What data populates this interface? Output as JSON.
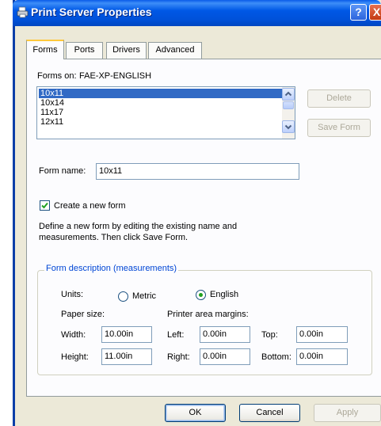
{
  "window": {
    "title": "Print Server Properties",
    "help_glyph": "?",
    "close_glyph": "X"
  },
  "tabs": [
    {
      "label": "Forms",
      "active": true
    },
    {
      "label": "Ports",
      "active": false
    },
    {
      "label": "Drivers",
      "active": false
    },
    {
      "label": "Advanced",
      "active": false
    }
  ],
  "forms": {
    "forms_on_label": "Forms on:",
    "server_name": "FAE-XP-ENGLISH",
    "items": [
      "10x11",
      "10x14",
      "11x17",
      "12x11"
    ],
    "selected_item": "10x11",
    "delete_label": "Delete",
    "save_form_label": "Save Form",
    "form_name_label": "Form name:",
    "form_name_value": "10x11",
    "create_new_label": "Create a new form",
    "create_new_checked": true,
    "description": "Define a new form by editing the existing name and measurements. Then click Save Form."
  },
  "measurements": {
    "group_title": "Form description (measurements)",
    "units_label": "Units:",
    "metric_label": "Metric",
    "english_label": "English",
    "selected_unit": "English",
    "paper_size_label": "Paper size:",
    "margins_label": "Printer area margins:",
    "width_label": "Width:",
    "width_value": "10.00in",
    "height_label": "Height:",
    "height_value": "11.00in",
    "left_label": "Left:",
    "left_value": "0.00in",
    "right_label": "Right:",
    "right_value": "0.00in",
    "top_label": "Top:",
    "top_value": "0.00in",
    "bottom_label": "Bottom:",
    "bottom_value": "0.00in"
  },
  "footer": {
    "ok_label": "OK",
    "cancel_label": "Cancel",
    "apply_label": "Apply"
  },
  "colors": {
    "title_bar": "#0054e3",
    "selection": "#316ac5",
    "group_title": "#0046d5",
    "accent_tab": "#ffc83c"
  }
}
